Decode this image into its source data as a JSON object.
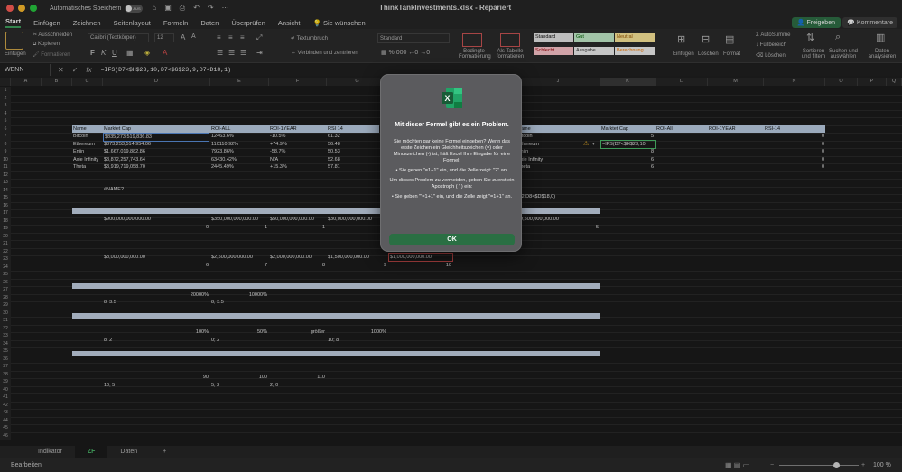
{
  "window": {
    "title": "ThinkTankInvestments.xlsx  -  Repariert",
    "autosave_label": "Automatisches Speichern",
    "autosave_state": "AUS"
  },
  "ribbon_tabs": [
    "Start",
    "Einfügen",
    "Zeichnen",
    "Seitenlayout",
    "Formeln",
    "Daten",
    "Überprüfen",
    "Ansicht",
    "Sie wünschen"
  ],
  "share_label": "Freigeben",
  "comments_label": "Kommentare",
  "ribbon": {
    "paste": "Einfügen",
    "cut": "Ausschneiden",
    "copy": "Kopieren",
    "format_painter": "Formatieren",
    "font_name": "Calibri (Textkörper)",
    "font_size": "12",
    "wrap": "Textumbruch",
    "merge": "Verbinden und zentrieren",
    "number_format": "Standard",
    "cond_format": "Bedingte Formatierung",
    "as_table": "Als Tabelle formatieren",
    "styles": [
      {
        "label": "Standard",
        "bg": "#e8e8e8",
        "fg": "#111111"
      },
      {
        "label": "Gut",
        "bg": "#c6efce",
        "fg": "#006100"
      },
      {
        "label": "Neutral",
        "bg": "#ffeb9c",
        "fg": "#9c5700"
      },
      {
        "label": "Schlecht",
        "bg": "#ffc7ce",
        "fg": "#9c0006"
      },
      {
        "label": "Ausgabe",
        "bg": "#f2f2f2",
        "fg": "#3f3f3f"
      },
      {
        "label": "Berechnung",
        "bg": "#f2f2f2",
        "fg": "#fa7d00"
      }
    ],
    "insert": "Einfügen",
    "delete": "Löschen",
    "format": "Format",
    "autosum": "AutoSumme",
    "fill": "Füllbereich",
    "clear": "Löschen",
    "sort": "Sortieren und filtern",
    "find": "Suchen und auswählen",
    "analyze": "Daten analysieren"
  },
  "formula_bar": {
    "name_box": "WENN",
    "formula": "=IFS(D7<$H$23,10,D7<$G$23,9,D7<D18,1)"
  },
  "columns": [
    "A",
    "B",
    "C",
    "D",
    "E",
    "F",
    "G",
    "H",
    "I",
    "J",
    "K",
    "L",
    "M",
    "N",
    "O",
    "P",
    "Q"
  ],
  "sheet": {
    "headers_left": [
      "Name",
      "Marktet Cap",
      "ROI-ALL",
      "ROI-1YEAR",
      "RSI 14"
    ],
    "rows_left": [
      [
        "Bitcoin",
        "$835,273,519,836.83",
        "12463.6%",
        "-10.5%",
        "61.32"
      ],
      [
        "Ethereum",
        "$373,253,514,954.06",
        "110110.92%",
        "+74.9%",
        "56.48"
      ],
      [
        "Enjin",
        "$1,667,019,882.86",
        "7923.86%",
        "-58.7%",
        "50.53"
      ],
      [
        "Axie Infinity",
        "$3,872,257,743.64",
        "63430.42%",
        "N/A",
        "52.68"
      ],
      [
        "Theta",
        "$3,919,719,058.70",
        "2445.49%",
        "+15.3%",
        "57.81"
      ]
    ],
    "headers_right": [
      "Name",
      "Marktet Cap",
      "ROI-All",
      "ROI-1YEAR",
      "RSI-14"
    ],
    "rows_right": [
      [
        "Bitcoin",
        "5",
        "0"
      ],
      [
        "Ethereum",
        "=IFS(D7<$H$23,10,",
        "0"
      ],
      [
        "Enjin",
        "8",
        "0"
      ],
      [
        "Axie Infinity",
        "6",
        "0"
      ],
      [
        "Theta",
        "6",
        "0"
      ]
    ],
    "error_cell": "#NAME?",
    "partial_formula": "8,2,D8<$D$18,0)",
    "row18": [
      "$900,000,000,000.00",
      "$350,000,000,000.00",
      "$50,000,000,000.00",
      "$30,000,000,000.00",
      "$9,500,000,000.00"
    ],
    "row19": [
      "0",
      "1",
      "1",
      "5"
    ],
    "row23": [
      "$8,000,000,000.00",
      "$2,500,000,000.00",
      "$2,000,000,000.00",
      "$1,500,000,000.00",
      "$1,000,000,000.00"
    ],
    "row24": [
      "6",
      "7",
      "8",
      "9",
      "10"
    ],
    "row28": [
      "20000%",
      "10000%"
    ],
    "row29": [
      "8; 3.5",
      "8; 3.5"
    ],
    "row33": [
      "100%",
      "50%",
      "größer",
      "1000%"
    ],
    "row34": [
      "8; 2",
      "0; 2",
      "10; 8"
    ],
    "row39": [
      "90",
      "100",
      "110"
    ],
    "row40": [
      "10; 5",
      "5; 2",
      "2; 0"
    ]
  },
  "sheet_tabs": [
    "Indikator",
    "ZF",
    "Daten",
    "+"
  ],
  "status": {
    "mode": "Bearbeiten",
    "zoom": "100 %"
  },
  "dialog": {
    "title": "Mit dieser Formel gibt es ein Problem.",
    "p1": "Sie möchten gar keine Formel eingeben? Wenn das erste Zeichen ein Gleichheitszeichen (=) oder Minuszeichen (-) ist, hält Excel Ihre Eingabe für eine Formel:",
    "p2": "• Sie geben \"=1+1\" ein, und die Zelle zeigt: \"2\" an.",
    "p3": "Um dieses Problem zu vermeiden, geben Sie zuerst ein Apostroph ( ' ) ein:",
    "p4": "• Sie geben \"'=1+1\" ein, und die Zelle zeigt \"=1+1\" an.",
    "ok": "OK"
  }
}
